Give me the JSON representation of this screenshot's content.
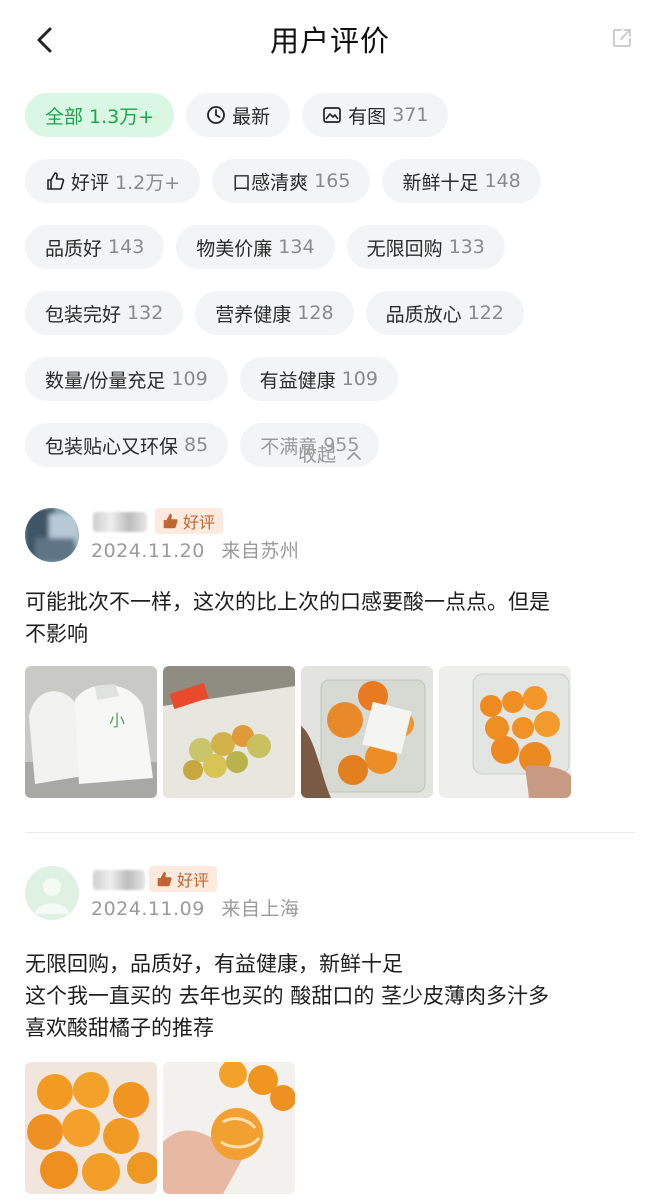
{
  "header": {
    "title": "用户评价"
  },
  "tags": {
    "rows": [
      [
        {
          "label": "全部",
          "count": "1.3万+",
          "active": true,
          "icon": ""
        },
        {
          "label": "最新",
          "count": "",
          "icon": "clock-icon"
        },
        {
          "label": "有图",
          "count": "371",
          "icon": "image-icon"
        }
      ],
      [
        {
          "label": "好评",
          "count": "1.2万+",
          "icon": "thumbs-up-icon"
        },
        {
          "label": "口感清爽",
          "count": "165",
          "icon": ""
        },
        {
          "label": "新鲜十足",
          "count": "148",
          "icon": ""
        }
      ],
      [
        {
          "label": "品质好",
          "count": "143",
          "icon": ""
        },
        {
          "label": "物美价廉",
          "count": "134",
          "icon": ""
        },
        {
          "label": "无限回购",
          "count": "133",
          "icon": ""
        }
      ],
      [
        {
          "label": "包装完好",
          "count": "132",
          "icon": ""
        },
        {
          "label": "营养健康",
          "count": "128",
          "icon": ""
        },
        {
          "label": "品质放心",
          "count": "122",
          "icon": ""
        }
      ],
      [
        {
          "label": "数量/份量充足",
          "count": "109",
          "icon": ""
        },
        {
          "label": "有益健康",
          "count": "109",
          "icon": ""
        }
      ],
      [
        {
          "label": "包装贴心又环保",
          "count": "85",
          "icon": ""
        },
        {
          "label": "不满意",
          "count": "955",
          "muted": true,
          "icon": ""
        }
      ]
    ],
    "collapse_label": "收起"
  },
  "reviews": [
    {
      "badge": "好评",
      "date": "2024.11.20",
      "location": "来自苏州",
      "text_lines": [
        "可能批次不一样，这次的比上次的口感要酸一点点。但是",
        "不影响"
      ],
      "photos": 4
    },
    {
      "badge": "好评",
      "date": "2024.11.09",
      "location": "来自上海",
      "text_lines": [
        "无限回购，品质好，有益健康，新鲜十足",
        "这个我一直买的 去年也买的 酸甜口的 茎少皮薄肉多汁多",
        "喜欢酸甜橘子的推荐"
      ],
      "photos": 2
    }
  ],
  "colors": {
    "accent": "#18a54b",
    "accent_bg": "#d9f7e2",
    "badge_bg": "#fde9de",
    "badge_text": "#c0652f"
  }
}
